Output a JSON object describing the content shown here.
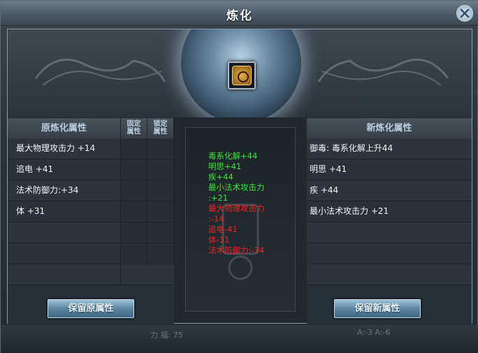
{
  "window": {
    "title": "炼化"
  },
  "left_table": {
    "header": "原炼化属性",
    "col_fixed": "固定",
    "col_fixed2": "属性",
    "col_lock": "锁定",
    "col_lock2": "属性",
    "rows": [
      "最大物理攻击力 +14",
      "追电 +41",
      "法术防御力:+34",
      "体 +31",
      "",
      "",
      ""
    ]
  },
  "preview": {
    "green_lines": [
      "毒系化解+44",
      "明思+41",
      "疾+44",
      "最小法术攻击力",
      ":+21"
    ],
    "red_lines": [
      "最大物理攻击力",
      ":-14",
      "追电-41",
      "体-31",
      "法术防御力:-34"
    ]
  },
  "right_table": {
    "header": "新炼化属性",
    "rows": [
      "御毒: 毒系化解上升44",
      "明思 +41",
      "疾 +44",
      "最小法术攻击力 +21",
      "",
      "",
      ""
    ]
  },
  "buttons": {
    "keep_original": "保留原属性",
    "keep_new": "保留新属性"
  },
  "background": {
    "hint1": "力 福: 75",
    "hint2": "A:-3 A:-6"
  }
}
